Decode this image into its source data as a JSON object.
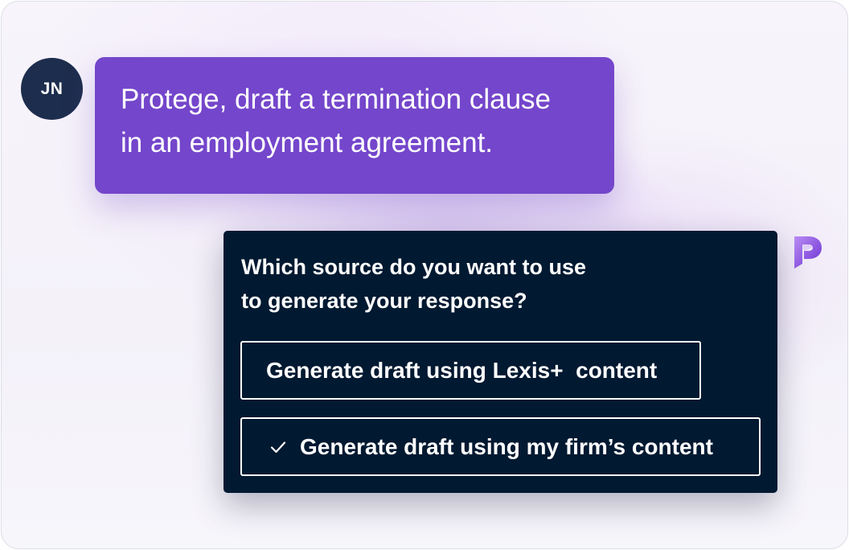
{
  "user": {
    "initials": "JN",
    "message_line1": "Protege, draft a termination clause",
    "message_line2": "in an employment agreement."
  },
  "assistant": {
    "question_line1": "Which source do you want to use",
    "question_line2": "to generate your response?",
    "options": [
      {
        "label": "Generate draft using Lexis+  content",
        "selected": false
      },
      {
        "label": "Generate draft using my firm’s content",
        "selected": true
      }
    ],
    "logo_icon": "protege-logo-icon"
  },
  "colors": {
    "user_bubble": "#7446cb",
    "avatar": "#1d2d4d",
    "card_background": "#011931",
    "logo_purple": "#8a4fe0"
  }
}
